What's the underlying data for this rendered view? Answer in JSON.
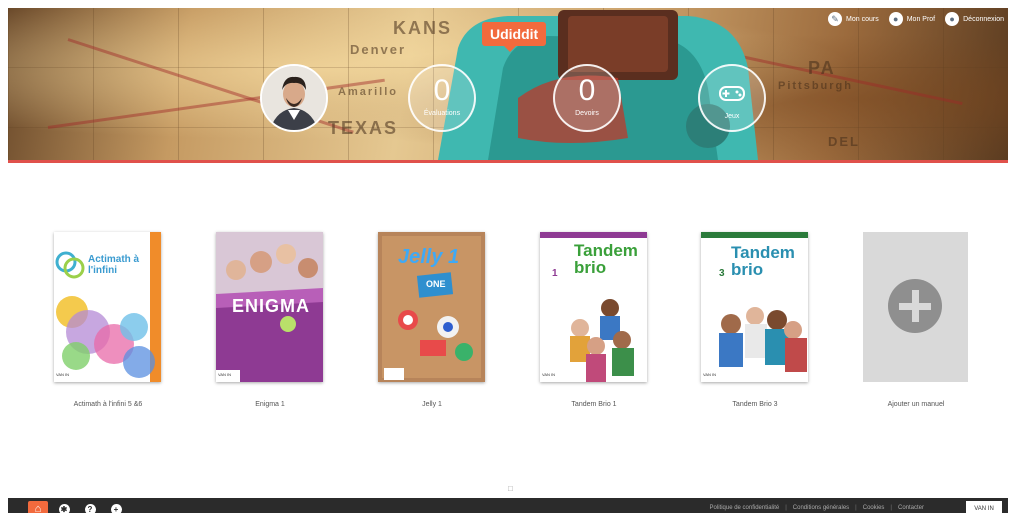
{
  "header": {
    "brand": "Udiddit",
    "map_labels": [
      "KANS",
      "Denver",
      "TEXAS",
      "Amarillo",
      "Pittsburgh",
      "PA",
      "DEL"
    ],
    "top_links": [
      {
        "icon": "edit-icon",
        "glyph": "✎",
        "label": "Mon cours"
      },
      {
        "icon": "user-icon",
        "glyph": "●",
        "label": "Mon Prof"
      },
      {
        "icon": "account-icon",
        "glyph": "●",
        "label": "Déconnexion"
      }
    ],
    "stats": [
      {
        "value": "0",
        "label": "Évaluations"
      },
      {
        "value": "0",
        "label": "Devoirs"
      },
      {
        "icon": "gamepad-icon",
        "label": "Jeux"
      }
    ]
  },
  "books": [
    {
      "caption": "Actimath à l'infini 5 &6",
      "cover_title": "Actimath à l'infini",
      "cover_color": "#ffffff",
      "accent": "#e5493f"
    },
    {
      "caption": "Enigma 1",
      "cover_title": "ENIGMA",
      "cover_color": "#8e3a93",
      "accent": "#b9e06a"
    },
    {
      "caption": "Jelly 1",
      "cover_title": "Jelly 1",
      "cover_sub": "ONE",
      "cover_color": "#b7845a",
      "accent": "#2f8fcf"
    },
    {
      "caption": "Tandem Brio 1",
      "cover_title": "Tandem brio",
      "cover_number": "1",
      "cover_color": "#ffffff",
      "accent": "#3aa03a"
    },
    {
      "caption": "Tandem Brio 3",
      "cover_title": "Tandem brio",
      "cover_number": "3",
      "cover_color": "#ffffff",
      "accent": "#2a8fb0"
    }
  ],
  "publisher_mark": "VAN IN",
  "add_manual": {
    "caption": "Ajouter un manuel"
  },
  "pager": "□",
  "footer": {
    "buttons": [
      {
        "name": "home-icon",
        "glyph": "⌂"
      },
      {
        "name": "settings-icon",
        "glyph": "✱"
      },
      {
        "name": "help-icon",
        "glyph": "?"
      },
      {
        "name": "add-icon",
        "glyph": "+"
      }
    ],
    "links": [
      "Politique de confidentialité",
      "Conditions générales",
      "Cookies",
      "Contacter"
    ],
    "badge": "VAN IN"
  }
}
